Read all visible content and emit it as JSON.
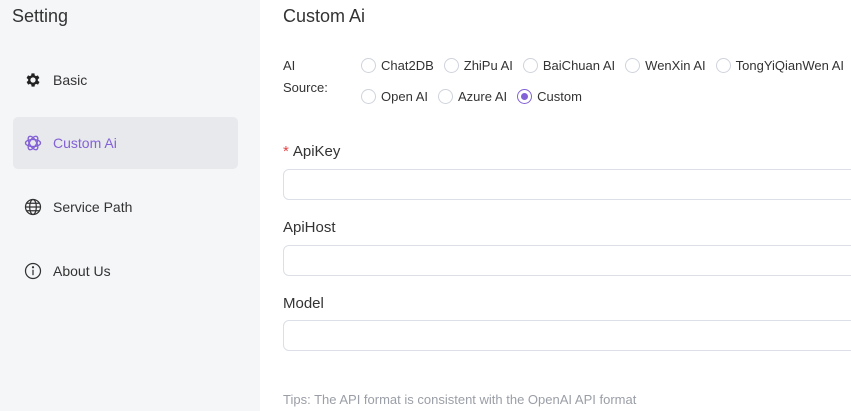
{
  "sidebar": {
    "title": "Setting",
    "items": [
      {
        "label": "Basic",
        "icon": "gear-icon",
        "active": false
      },
      {
        "label": "Custom Ai",
        "icon": "openai-icon",
        "active": true
      },
      {
        "label": "Service Path",
        "icon": "globe-icon",
        "active": false
      },
      {
        "label": "About Us",
        "icon": "info-icon",
        "active": false
      }
    ]
  },
  "main": {
    "title": "Custom Ai",
    "ai_source": {
      "label": "AI Source:",
      "options": [
        "Chat2DB",
        "ZhiPu AI",
        "BaiChuan AI",
        "WenXin AI",
        "TongYiQianWen AI",
        "Open AI",
        "Azure AI",
        "Custom"
      ],
      "selected": "Custom"
    },
    "fields": [
      {
        "label": "ApiKey",
        "required": true,
        "value": "",
        "placeholder": ""
      },
      {
        "label": "ApiHost",
        "required": false,
        "value": "",
        "placeholder": ""
      },
      {
        "label": "Model",
        "required": false,
        "value": "",
        "placeholder": ""
      }
    ],
    "tips": "Tips: The API format is consistent with the OpenAI API format"
  },
  "colors": {
    "accent": "#8361d6",
    "sidebar_bg": "#f5f6f8",
    "active_item_bg": "#e8e9ed",
    "required_mark": "#e54545",
    "tips_text": "#9a9ea6"
  }
}
